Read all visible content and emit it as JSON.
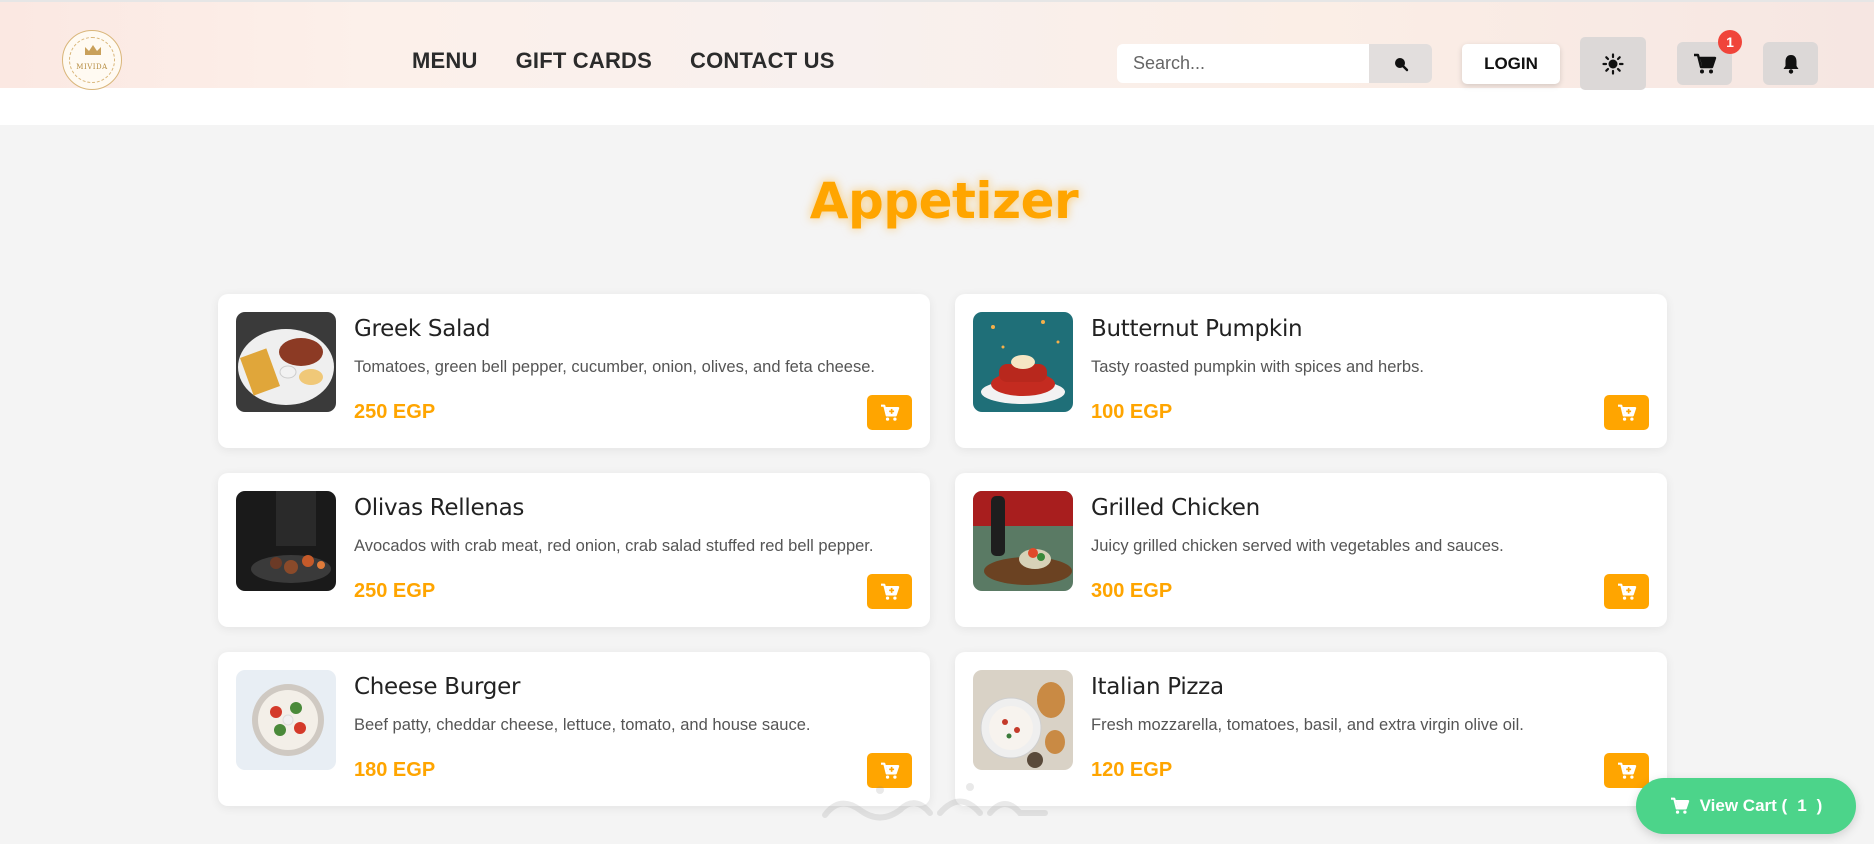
{
  "header": {
    "logo_text": "MIVIDA",
    "nav": [
      "MENU",
      "GIFT CARDS",
      "CONTACT US"
    ],
    "search_placeholder": "Search...",
    "login_label": "LOGIN",
    "cart_count": "1"
  },
  "section": {
    "title": "Appetizer"
  },
  "items": [
    {
      "name": "Greek Salad",
      "desc": "Tomatoes, green bell pepper, cucumber, onion, olives, and feta cheese.",
      "price": "250 EGP"
    },
    {
      "name": "Butternut Pumpkin",
      "desc": "Tasty roasted pumpkin with spices and herbs.",
      "price": "100 EGP"
    },
    {
      "name": "Olivas Rellenas",
      "desc": "Avocados with crab meat, red onion, crab salad stuffed red bell pepper.",
      "price": "250 EGP"
    },
    {
      "name": "Grilled Chicken",
      "desc": "Juicy grilled chicken served with vegetables and sauces.",
      "price": "300 EGP"
    },
    {
      "name": "Cheese Burger",
      "desc": "Beef patty, cheddar cheese, lettuce, tomato, and house sauce.",
      "price": "180 EGP"
    },
    {
      "name": "Italian Pizza",
      "desc": "Fresh mozzarella, tomatoes, basil, and extra virgin olive oil.",
      "price": "120 EGP"
    }
  ],
  "floating_cart": {
    "label": "View Cart (",
    "count": "1",
    "close": ")"
  },
  "icons": [
    "search-icon",
    "sun-icon",
    "cart-icon",
    "bell-icon",
    "add-to-cart-icon"
  ],
  "colors": {
    "accent": "#ffa500",
    "cart_green": "#4cd48a",
    "badge_red": "#f0443a"
  }
}
